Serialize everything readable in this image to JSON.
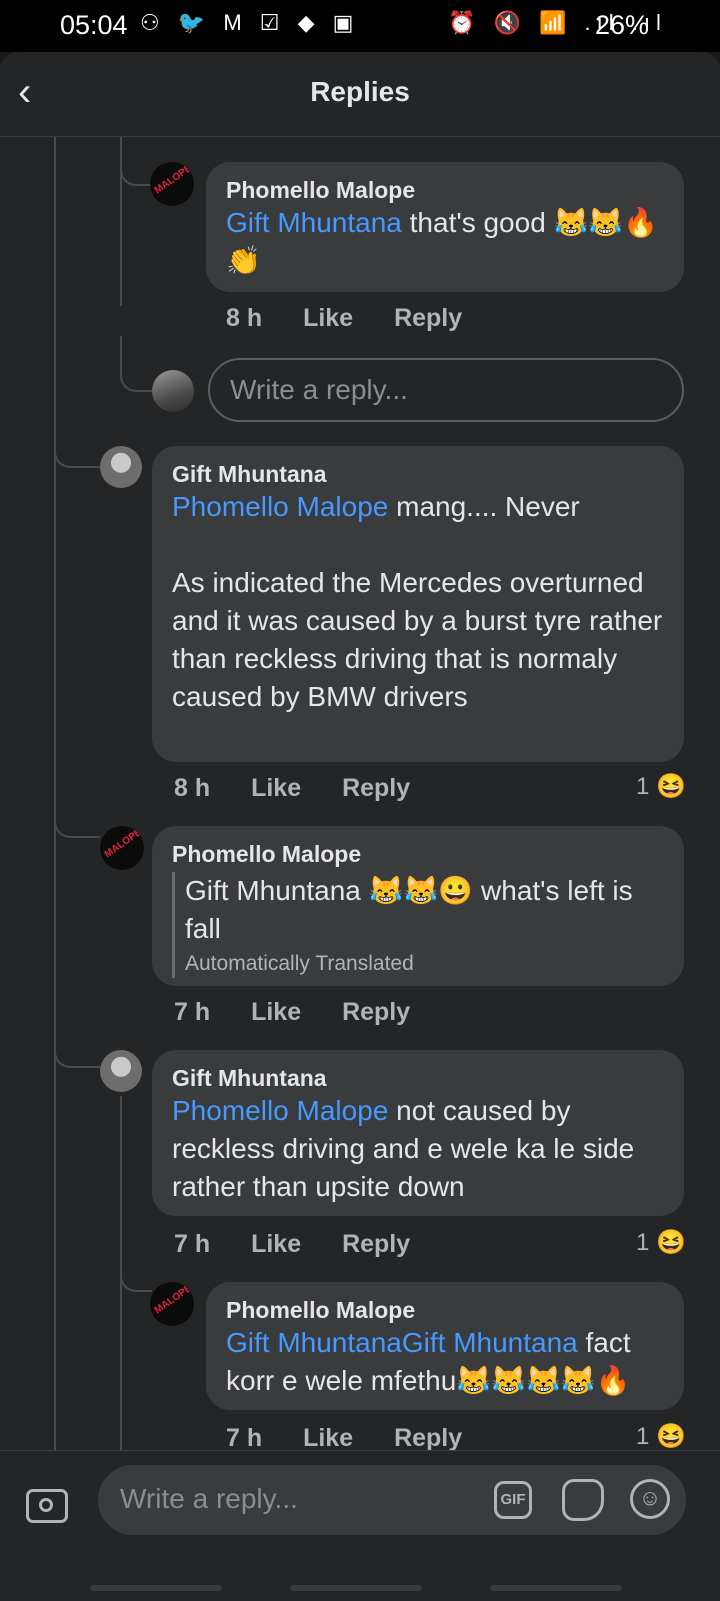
{
  "status_bar": {
    "time": "05:04",
    "left_icons": "⚇ 🐦 M ☑ ◆ ▣",
    "right_icons": "⏰ 🔇 📶 .ıl .ıl",
    "battery": "26%"
  },
  "header": {
    "title": "Replies",
    "back_icon": "chevron-left-icon"
  },
  "comments": [
    {
      "author": "Phomello Malope",
      "mention": "Gift Mhuntana",
      "text": " that's good ",
      "emoji": "😹😹🔥👏",
      "time": "8 h",
      "like": "Like",
      "reply": "Reply"
    },
    {
      "author": "Gift Mhuntana",
      "mention": "Phomello Malope",
      "text": " mang.... Never\n\nAs indicated the Mercedes overturned and it was caused by a burst tyre rather than reckless driving that is normaly caused by BMW drivers",
      "time": "8 h",
      "like": "Like",
      "reply": "Reply",
      "reactions": "1",
      "reaction_emoji": "😆"
    },
    {
      "author": "Phomello Malope",
      "text": "Gift Mhuntana ",
      "emoji": "😹😹😀",
      "text2": " what's left is fall",
      "translated": "Automatically Translated",
      "time": "7 h",
      "like": "Like",
      "reply": "Reply"
    },
    {
      "author": "Gift Mhuntana",
      "mention": "Phomello Malope",
      "text": " not caused by reckless driving and e wele ka le side rather than upsite down",
      "time": "7 h",
      "like": "Like",
      "reply": "Reply",
      "reactions": "1",
      "reaction_emoji": "😆"
    },
    {
      "author": "Phomello Malope",
      "mention": "Gift MhuntanaGift Mhuntana",
      "text": " fact korr e wele mfethu",
      "emoji": "😹😹😹😹🔥",
      "time": "7 h",
      "like": "Like",
      "reply": "Reply",
      "reactions": "1",
      "reaction_emoji": "😆"
    }
  ],
  "inline_reply": {
    "placeholder": "Write a reply..."
  },
  "composer": {
    "placeholder": "Write a reply...",
    "gif_label": "GIF",
    "emoji_glyph": "☺"
  },
  "avatar_label": "MALOPE"
}
